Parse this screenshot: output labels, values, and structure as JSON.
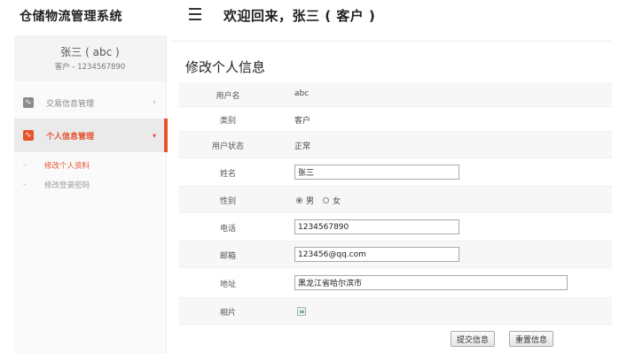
{
  "header": {
    "app_title": "仓储物流管理系统",
    "welcome": "欢迎回来，张三 ( 客户 )"
  },
  "sidebar": {
    "user_name": "张三 ( abc )",
    "user_sub": "客户 - 1234567890",
    "items": [
      {
        "label": "交易信息管理",
        "arrow": "›",
        "icon": "chart-icon"
      },
      {
        "label": "个人信息管理",
        "arrow": "▾",
        "icon": "chart-icon"
      }
    ],
    "sub_items": [
      {
        "dash": "-",
        "label": "修改个人资料"
      },
      {
        "dash": "-",
        "label": "修改登录密码"
      }
    ]
  },
  "panel": {
    "title": "修改个人信息",
    "rows": [
      {
        "label": "用户名",
        "value": "abc"
      },
      {
        "label": "类别",
        "value": "客户"
      },
      {
        "label": "用户状态",
        "value": "正常"
      },
      {
        "label": "姓名",
        "value": "张三"
      },
      {
        "label": "性别",
        "options": [
          "男",
          "女"
        ],
        "selected": "男"
      },
      {
        "label": "电话",
        "value": "1234567890"
      },
      {
        "label": "邮箱",
        "value": "123456@qq.com"
      },
      {
        "label": "地址",
        "value": "黑龙江省哈尔滨市"
      },
      {
        "label": "相片",
        "value": "broken-image-icon"
      }
    ],
    "submit_label": "提交信息",
    "reset_label": "重置信息"
  }
}
